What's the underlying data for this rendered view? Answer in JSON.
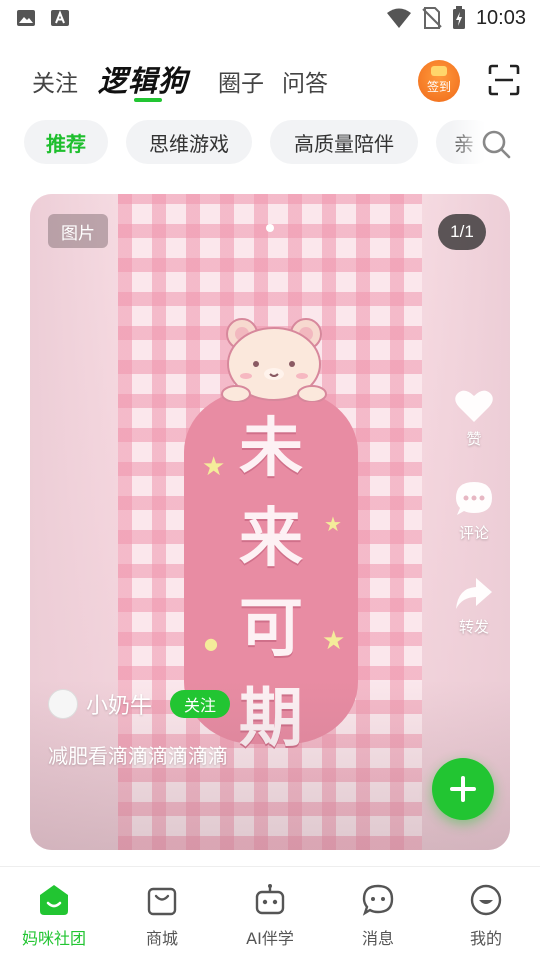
{
  "status_bar": {
    "time": "10:03",
    "left_icons": [
      "image-icon",
      "font-icon"
    ],
    "right_icons": [
      "wifi-icon",
      "no-sim-icon",
      "battery-charging-icon"
    ]
  },
  "top_nav": {
    "follow_label": "关注",
    "brand_label": "逻辑狗",
    "circle_label": "圈子",
    "qa_label": "问答",
    "signin_label": "签到",
    "scan_icon": "scan-icon"
  },
  "chips": {
    "items": [
      "推荐",
      "思维游戏",
      "高质量陪伴",
      "亲"
    ],
    "active_index": 0
  },
  "post": {
    "type_badge": "图片",
    "page_counter": "1/1",
    "image_text": [
      "未",
      "来",
      "可",
      "期"
    ],
    "author_name": "小奶牛",
    "follow_label": "关注",
    "description": "减肥看滴滴滴滴滴滴",
    "actions": {
      "like_label": "赞",
      "comment_label": "评论",
      "share_label": "转发"
    }
  },
  "bottom_nav": {
    "items": [
      {
        "label": "妈咪社团",
        "icon": "community-icon"
      },
      {
        "label": "商城",
        "icon": "shop-bag-icon"
      },
      {
        "label": "AI伴学",
        "icon": "robot-icon"
      },
      {
        "label": "消息",
        "icon": "message-icon"
      },
      {
        "label": "我的",
        "icon": "profile-icon"
      }
    ],
    "active_index": 0
  },
  "colors": {
    "accent": "#22c532",
    "signin_orange": "#f06a1a",
    "card_pink": "#e88ca3"
  }
}
